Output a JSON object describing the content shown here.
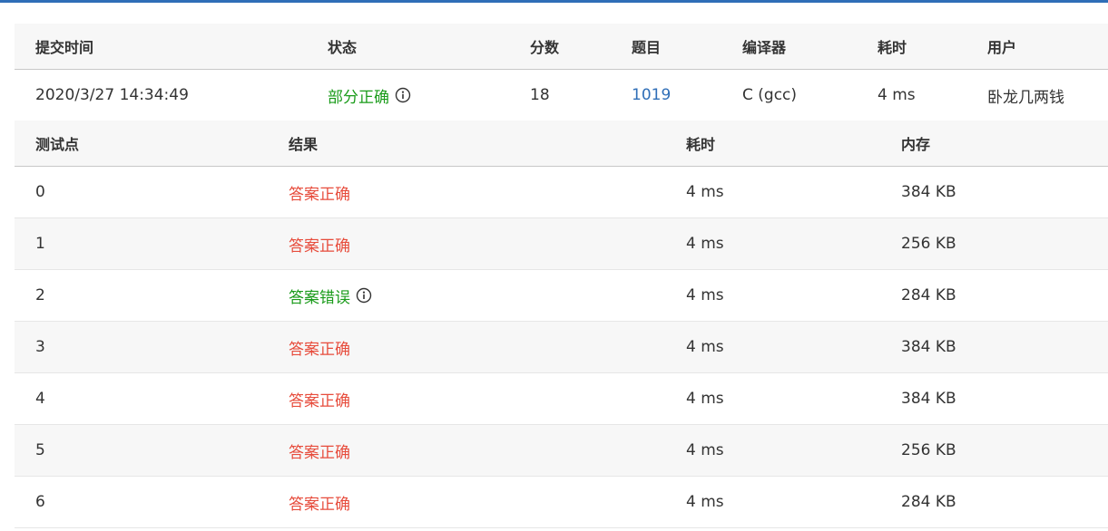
{
  "submission": {
    "headers": {
      "time": "提交时间",
      "status": "状态",
      "score": "分数",
      "problem": "题目",
      "compiler": "编译器",
      "cost": "耗时",
      "user": "用户"
    },
    "row": {
      "time": "2020/3/27 14:34:49",
      "status": "部分正确",
      "score": "18",
      "problem": "1019",
      "compiler": "C (gcc)",
      "cost": "4 ms",
      "user": "卧龙几两钱"
    }
  },
  "testcases": {
    "headers": {
      "id": "测试点",
      "result": "结果",
      "time": "耗时",
      "memory": "内存"
    },
    "rows": [
      {
        "id": "0",
        "result": "答案正确",
        "time": "4 ms",
        "memory": "384 KB",
        "status": "ok"
      },
      {
        "id": "1",
        "result": "答案正确",
        "time": "4 ms",
        "memory": "256 KB",
        "status": "ok"
      },
      {
        "id": "2",
        "result": "答案错误",
        "time": "4 ms",
        "memory": "284 KB",
        "status": "wrong"
      },
      {
        "id": "3",
        "result": "答案正确",
        "time": "4 ms",
        "memory": "384 KB",
        "status": "ok"
      },
      {
        "id": "4",
        "result": "答案正确",
        "time": "4 ms",
        "memory": "384 KB",
        "status": "ok"
      },
      {
        "id": "5",
        "result": "答案正确",
        "time": "4 ms",
        "memory": "256 KB",
        "status": "ok"
      },
      {
        "id": "6",
        "result": "答案正确",
        "time": "4 ms",
        "memory": "284 KB",
        "status": "ok"
      }
    ]
  },
  "colors": {
    "accent": "#2f6eb7",
    "correct": "#e74c3c",
    "wrong": "#1a9b1a",
    "header_bg": "#f7f7f7"
  },
  "icons": {
    "status_info": "info-circle-icon"
  }
}
